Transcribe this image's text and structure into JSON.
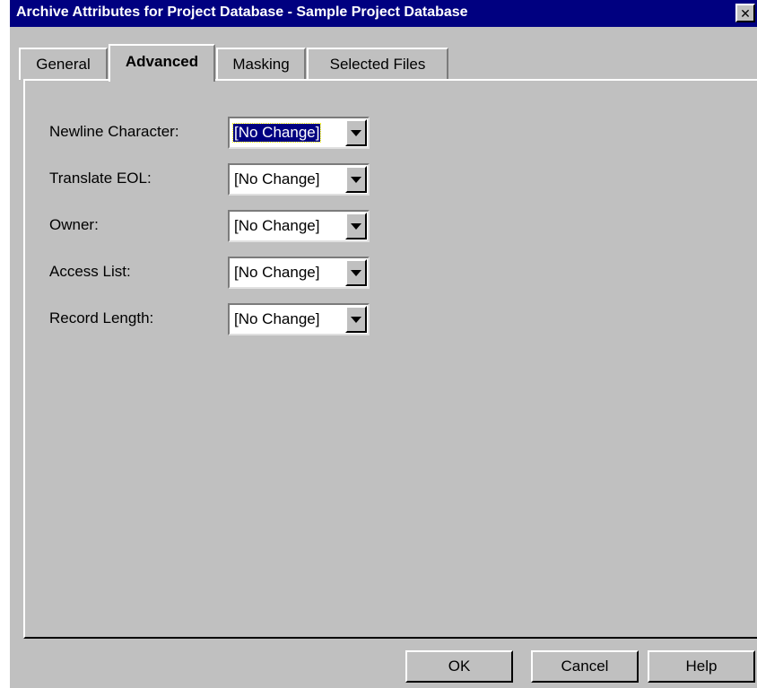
{
  "window": {
    "title": "Archive Attributes for Project Database - Sample Project Database",
    "close_glyph": "✕"
  },
  "tabs": [
    {
      "label": "General",
      "active": false
    },
    {
      "label": "Advanced",
      "active": true
    },
    {
      "label": "Masking",
      "active": false
    },
    {
      "label": "Selected Files",
      "active": false
    }
  ],
  "fields": [
    {
      "label": "Newline Character:",
      "value": "[No Change]",
      "focused": true
    },
    {
      "label": "Translate EOL:",
      "value": "[No Change]",
      "focused": false
    },
    {
      "label": "Owner:",
      "value": "[No Change]",
      "focused": false
    },
    {
      "label": "Access List:",
      "value": "[No Change]",
      "focused": false
    },
    {
      "label": "Record Length:",
      "value": "[No Change]",
      "focused": false
    }
  ],
  "buttons": {
    "ok": "OK",
    "cancel": "Cancel",
    "help": "Help"
  },
  "colors": {
    "titlebar": "#000080",
    "face": "#c0c0c0",
    "selection": "#000080"
  },
  "icons": {
    "close": "close-icon",
    "dropdown": "chevron-down-icon"
  }
}
